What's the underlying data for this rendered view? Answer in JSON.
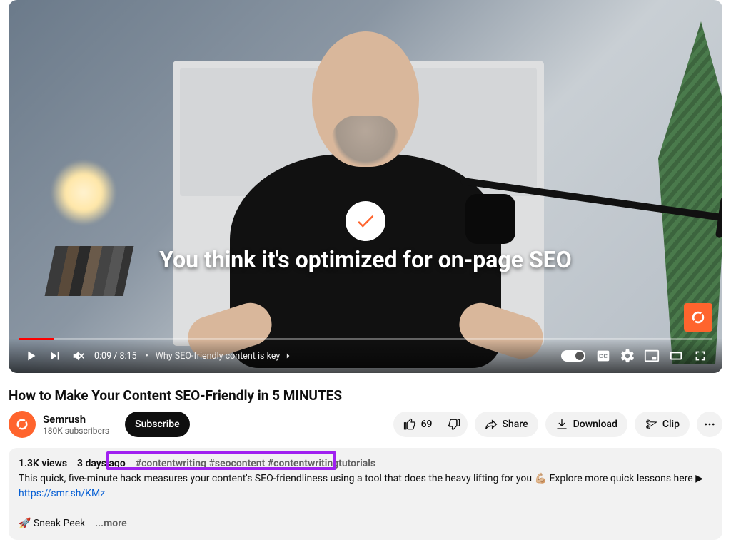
{
  "player": {
    "caption": "You think it's optimized for on-page SEO",
    "current_time": "0:09",
    "duration": "8:15",
    "chapter": "Why SEO-friendly content is key"
  },
  "video": {
    "title": "How to Make Your Content SEO-Friendly in 5 MINUTES"
  },
  "channel": {
    "name": "Semrush",
    "subscribers": "180K subscribers"
  },
  "actions": {
    "subscribe": "Subscribe",
    "like_count": "69",
    "share": "Share",
    "download": "Download",
    "clip": "Clip"
  },
  "description": {
    "views": "1.3K views",
    "age": "3 days ago",
    "hashtags": "#contentwriting #seocontent #contentwritingtutorials",
    "line1_a": "This quick, five-minute hack measures your content's SEO-friendliness using a tool that does the heavy lifting for you 💪🏼  Explore more quick lessons here ▶ ",
    "link1": "https://smr.sh/KMz",
    "line2": "🚀 Sneak Peek",
    "more": "...more"
  }
}
